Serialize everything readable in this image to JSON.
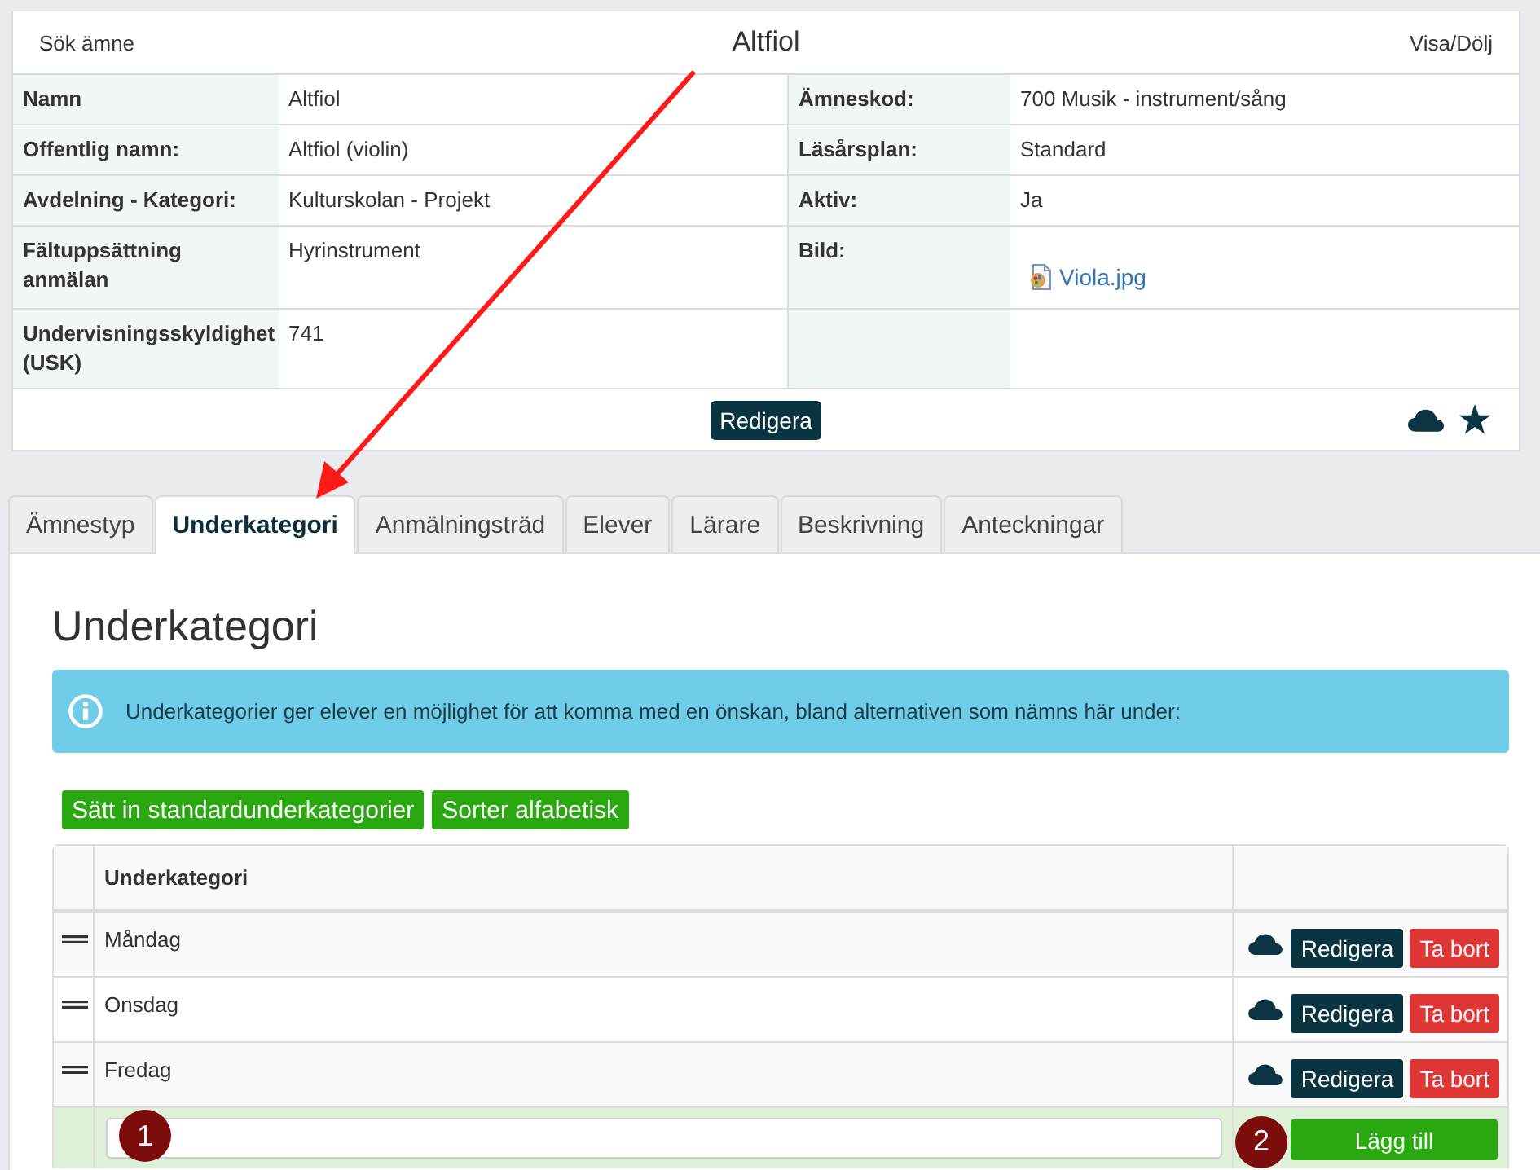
{
  "panel": {
    "search_link": "Sök ämne",
    "title": "Altfiol",
    "toggle_link": "Visa/Dölj",
    "details": [
      [
        {
          "label": "Namn",
          "value": "Altfiol"
        },
        {
          "label": "Ämneskod:",
          "value": "700 Musik - instrument/sång"
        }
      ],
      [
        {
          "label": "Offentlig namn:",
          "value": "Altfiol (violin)"
        },
        {
          "label": "Läsårsplan:",
          "value": "Standard"
        }
      ],
      [
        {
          "label": "Avdelning - Kategori:",
          "value": "Kulturskolan - Projekt"
        },
        {
          "label": "Aktiv:",
          "value": "Ja"
        }
      ],
      [
        {
          "label": "Fältuppsättning anmälan",
          "value": "Hyrinstrument"
        },
        {
          "label": "Bild:",
          "file": "Viola.jpg"
        }
      ],
      [
        {
          "label": "Undervisningsskyldighet (USK)",
          "value": "741"
        }
      ]
    ],
    "edit_button": "Redigera"
  },
  "tabs": [
    {
      "label": "Ämnestyp",
      "selected": false
    },
    {
      "label": "Underkategori",
      "selected": true
    },
    {
      "label": "Anmälningsträd",
      "selected": false
    },
    {
      "label": "Elever",
      "selected": false
    },
    {
      "label": "Lärare",
      "selected": false
    },
    {
      "label": "Beskrivning",
      "selected": false
    },
    {
      "label": "Anteckningar",
      "selected": false
    }
  ],
  "subcategory": {
    "heading": "Underkategori",
    "info": "Underkategorier ger elever en möjlighet för att komma med en önskan, bland alternativen som nämns här under:",
    "actions": [
      "Sätt in standardunderkategorier",
      "Sorter alfabetisk"
    ],
    "table": {
      "columns": [
        "Underkategori"
      ],
      "rows": [
        {
          "name": "Måndag",
          "buttons": [
            {
              "label": "Redigera",
              "kind": "edit"
            },
            {
              "label": "Ta bort",
              "kind": "delete"
            }
          ]
        },
        {
          "name": "Onsdag",
          "buttons": [
            {
              "label": "Redigera",
              "kind": "edit"
            },
            {
              "label": "Ta bort",
              "kind": "delete"
            }
          ]
        },
        {
          "name": "Fredag",
          "buttons": [
            {
              "label": "Redigera",
              "kind": "edit"
            },
            {
              "label": "Ta bort",
              "kind": "delete"
            }
          ]
        }
      ],
      "add_button": "Lägg till"
    }
  },
  "annotations": {
    "markers": [
      "1",
      "2"
    ]
  }
}
